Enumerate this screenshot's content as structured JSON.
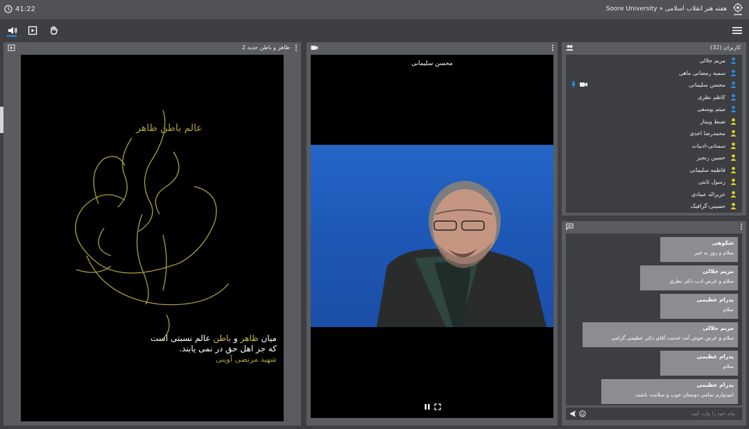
{
  "topbar": {
    "time": "41:22",
    "breadcrumb": "Soore University » هفته هنر انقلاب اسلامی"
  },
  "presentation": {
    "title": "ظاهر و باطن جدید 2",
    "poster_calligraphy": "عالم باطن ظاهر",
    "poster_line1_a": "میان ",
    "poster_line1_b": "ظاهر",
    "poster_line1_c": " و ",
    "poster_line1_d": "باطن",
    "poster_line1_e": " عالم نسبتی است",
    "poster_line2": "که جز اهل حق در نمی یابند.",
    "poster_line3": "شهید مرتضی آوینی"
  },
  "video": {
    "speaker": "محسن سلیمانی"
  },
  "users": {
    "title": "کاربران (32)",
    "items": [
      {
        "name": "مریم جلالی",
        "color": "#2b8ceb",
        "mic": false,
        "cam": false
      },
      {
        "name": "سمیه رمضانی ماهی",
        "color": "#2b8ceb",
        "mic": false,
        "cam": false
      },
      {
        "name": "محسن سلیمانی",
        "color": "#2b8ceb",
        "mic": true,
        "cam": true
      },
      {
        "name": "کاظم نظری",
        "color": "#2b8ceb",
        "mic": false,
        "cam": false
      },
      {
        "name": "میثم یوسفی",
        "color": "#2b8ceb",
        "mic": false,
        "cam": false
      },
      {
        "name": "ضبط وبینار",
        "color": "#e6d21e",
        "mic": false,
        "cam": false
      },
      {
        "name": "محمدرضا اخدی",
        "color": "#e6d21e",
        "mic": false,
        "cam": false
      },
      {
        "name": "سمنانی-ادبیات",
        "color": "#e6d21e",
        "mic": false,
        "cam": false
      },
      {
        "name": "حسین رنجبر",
        "color": "#e6d21e",
        "mic": false,
        "cam": false
      },
      {
        "name": "فاطمه سلیمانی",
        "color": "#e6d21e",
        "mic": false,
        "cam": false
      },
      {
        "name": "رسول ثابتی",
        "color": "#e6d21e",
        "mic": false,
        "cam": false
      },
      {
        "name": "عزیزاله عمادی",
        "color": "#e6d21e",
        "mic": false,
        "cam": false
      },
      {
        "name": "حسینی-گرافیک",
        "color": "#e6d21e",
        "mic": false,
        "cam": false
      }
    ]
  },
  "chat": {
    "messages": [
      {
        "name": "شکوهی",
        "text": "سلام و روز به خیر"
      },
      {
        "name": "مریم جلالی",
        "text": "سلام و عرض ادب دکتر نظری"
      },
      {
        "name": "پدرام عظیمی",
        "text": "سلام"
      },
      {
        "name": "مریم جلالی",
        "text": "سلام و عرض خوش آمد خدمت آقای دکتر عظیمی گرامی"
      },
      {
        "name": "پدرام عظیمی",
        "text": "سلام"
      },
      {
        "name": "پدرام عظیمی",
        "text": "امیدوارم تمامی دوستان خوب و سلامت باشند."
      }
    ],
    "input_placeholder": "پیام خود را وارد کنید."
  }
}
